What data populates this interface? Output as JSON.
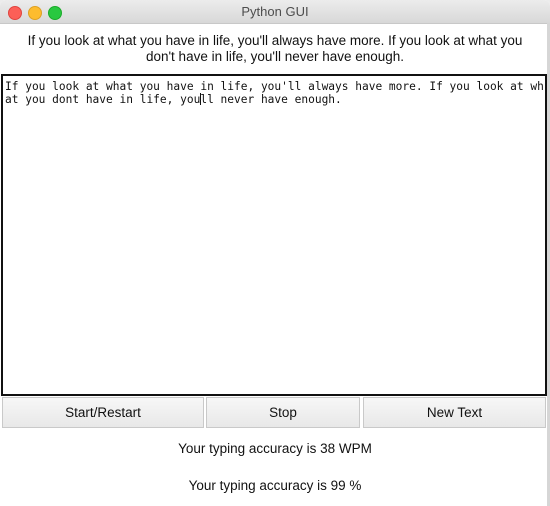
{
  "window": {
    "title": "Python GUI",
    "controls": [
      "close",
      "minimize",
      "maximize"
    ]
  },
  "prompt_text": "If you look at what you have in life, you'll always have more. If you look at what you don't have in life, you'll never have enough.",
  "textbox": {
    "line1": "If you look at what you have in life, you'll always have more. If you look at wh",
    "line2_before_caret": "at you dont have in life, you",
    "line2_after_caret": "ll never have enough."
  },
  "buttons": {
    "start": "Start/Restart",
    "stop": "Stop",
    "new_text": "New Text"
  },
  "results": {
    "wpm": "Your typing accuracy is 38 WPM",
    "accuracy": "Your typing accuracy is 99 %"
  }
}
